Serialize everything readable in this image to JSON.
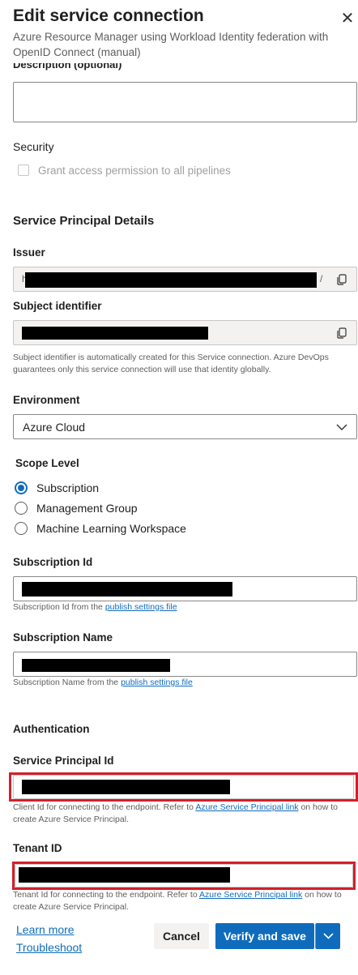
{
  "header": {
    "title": "Edit service connection",
    "subtitle": "Azure Resource Manager using Workload Identity federation with OpenID Connect (manual)",
    "close_glyph": "✕"
  },
  "description": {
    "label": "Description (optional)",
    "value": ""
  },
  "security": {
    "label": "Security",
    "checkbox_label": "Grant access permission to all pipelines",
    "checked": false
  },
  "sp_details": {
    "heading": "Service Principal Details"
  },
  "issuer": {
    "label": "Issuer",
    "prefix_char": "h",
    "suffix_char": "/"
  },
  "subject": {
    "label": "Subject identifier",
    "help": "Subject identifier is automatically created for this Service connection. Azure DevOps guarantees only this service connection will use that identity globally."
  },
  "environment": {
    "label": "Environment",
    "value": "Azure Cloud"
  },
  "scope": {
    "label": "Scope Level",
    "options": [
      "Subscription",
      "Management Group",
      "Machine Learning Workspace"
    ],
    "selected": "Subscription"
  },
  "subscription_id": {
    "label": "Subscription Id",
    "help_prefix": "Subscription Id from the ",
    "help_link": "publish settings file"
  },
  "subscription_name": {
    "label": "Subscription Name",
    "help_prefix": "Subscription Name from the ",
    "help_link": "publish settings file"
  },
  "authentication": {
    "label": "Authentication"
  },
  "sp_id": {
    "label": "Service Principal Id",
    "help_prefix": "Client Id for connecting to the endpoint. Refer to ",
    "help_link": "Azure Service Principal link",
    "help_suffix": " on how to create Azure Service Principal."
  },
  "tenant": {
    "label": "Tenant ID",
    "help_prefix": "Tenant Id for connecting to the endpoint. Refer to ",
    "help_link": "Azure Service Principal link",
    "help_suffix": " on how to create Azure Service Principal."
  },
  "footer": {
    "learn_more": "Learn more",
    "troubleshoot": "Troubleshoot",
    "cancel": "Cancel",
    "verify_save": "Verify and save"
  },
  "icons": {
    "close": "close-icon",
    "copy": "copy-icon",
    "dropdown": "chevron-down-icon"
  },
  "colors": {
    "accent": "#0f6cbd",
    "highlight": "#d32029",
    "redaction": "#000000"
  }
}
